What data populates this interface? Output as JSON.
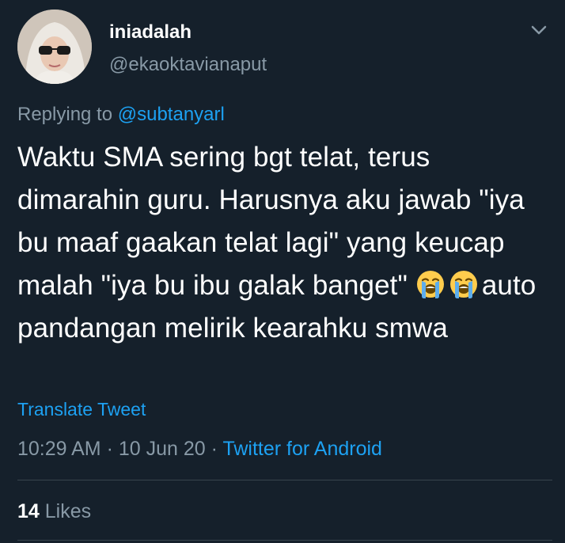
{
  "user": {
    "display_name": "iniadalah",
    "handle": "@ekaoktavianaput"
  },
  "reply": {
    "prefix": "Replying to",
    "mention": "@subtanyarl"
  },
  "tweet": {
    "text_before_emoji": "Waktu SMA sering bgt telat, terus dimarahin guru. Harusnya aku jawab \"iya bu maaf gaakan telat lagi\" yang keucap malah \"iya bu ibu galak banget\"",
    "emojis": [
      "loudly-crying-face",
      "loudly-crying-face"
    ],
    "text_after_emoji": "auto pandangan melirik kearahku smwa"
  },
  "translate_label": "Translate Tweet",
  "meta": {
    "time": "10:29 AM",
    "separator": "·",
    "date": "10 Jun 20",
    "source": "Twitter for Android"
  },
  "stats": {
    "likes_count": "14",
    "likes_label": "Likes"
  },
  "colors": {
    "background": "#15202b",
    "accent": "#1da1f2",
    "secondary_text": "#8899a6",
    "divider": "#38444d"
  },
  "icons": {
    "menu": "chevron-down-icon"
  }
}
